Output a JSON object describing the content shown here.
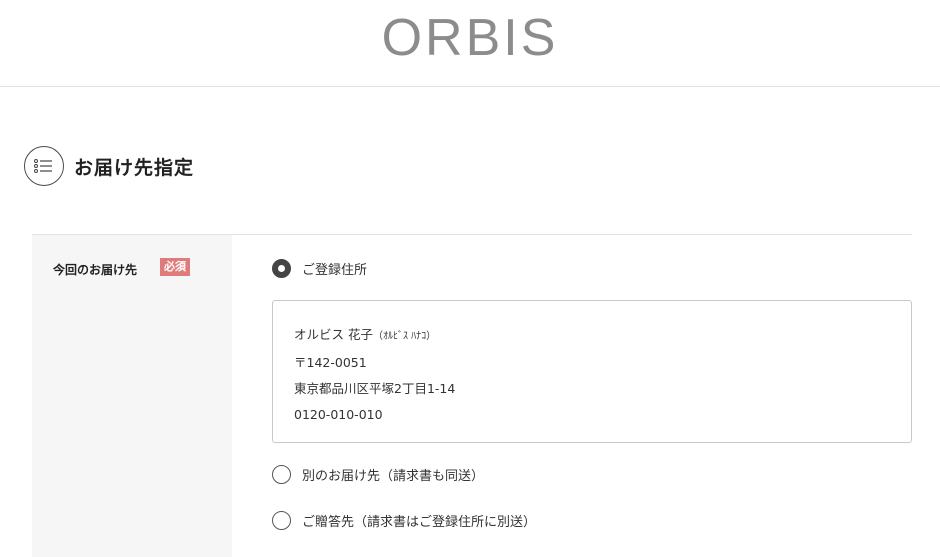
{
  "header": {
    "logo_text": "ORBIS"
  },
  "section": {
    "title": "お届け先指定",
    "icon": "list-icon"
  },
  "form": {
    "label": "今回のお届け先",
    "required_badge": "必須",
    "options": [
      {
        "label": "ご登録住所",
        "selected": true
      },
      {
        "label": "別のお届け先（請求書も同送）",
        "selected": false
      },
      {
        "label": "ご贈答先（請求書はご登録住所に別送）",
        "selected": false
      }
    ],
    "registered_address": {
      "name": "オルビス 花子",
      "name_kana": "（ｵﾙﾋﾞｽ ﾊﾅｺ）",
      "postal_code": "〒142-0051",
      "address": "東京都品川区平塚2丁目1-14",
      "phone": "0120-010-010"
    }
  },
  "colors": {
    "badge": "#e07b7b",
    "label_bg": "#f6f6f6",
    "logo": "#8c8c8c"
  }
}
